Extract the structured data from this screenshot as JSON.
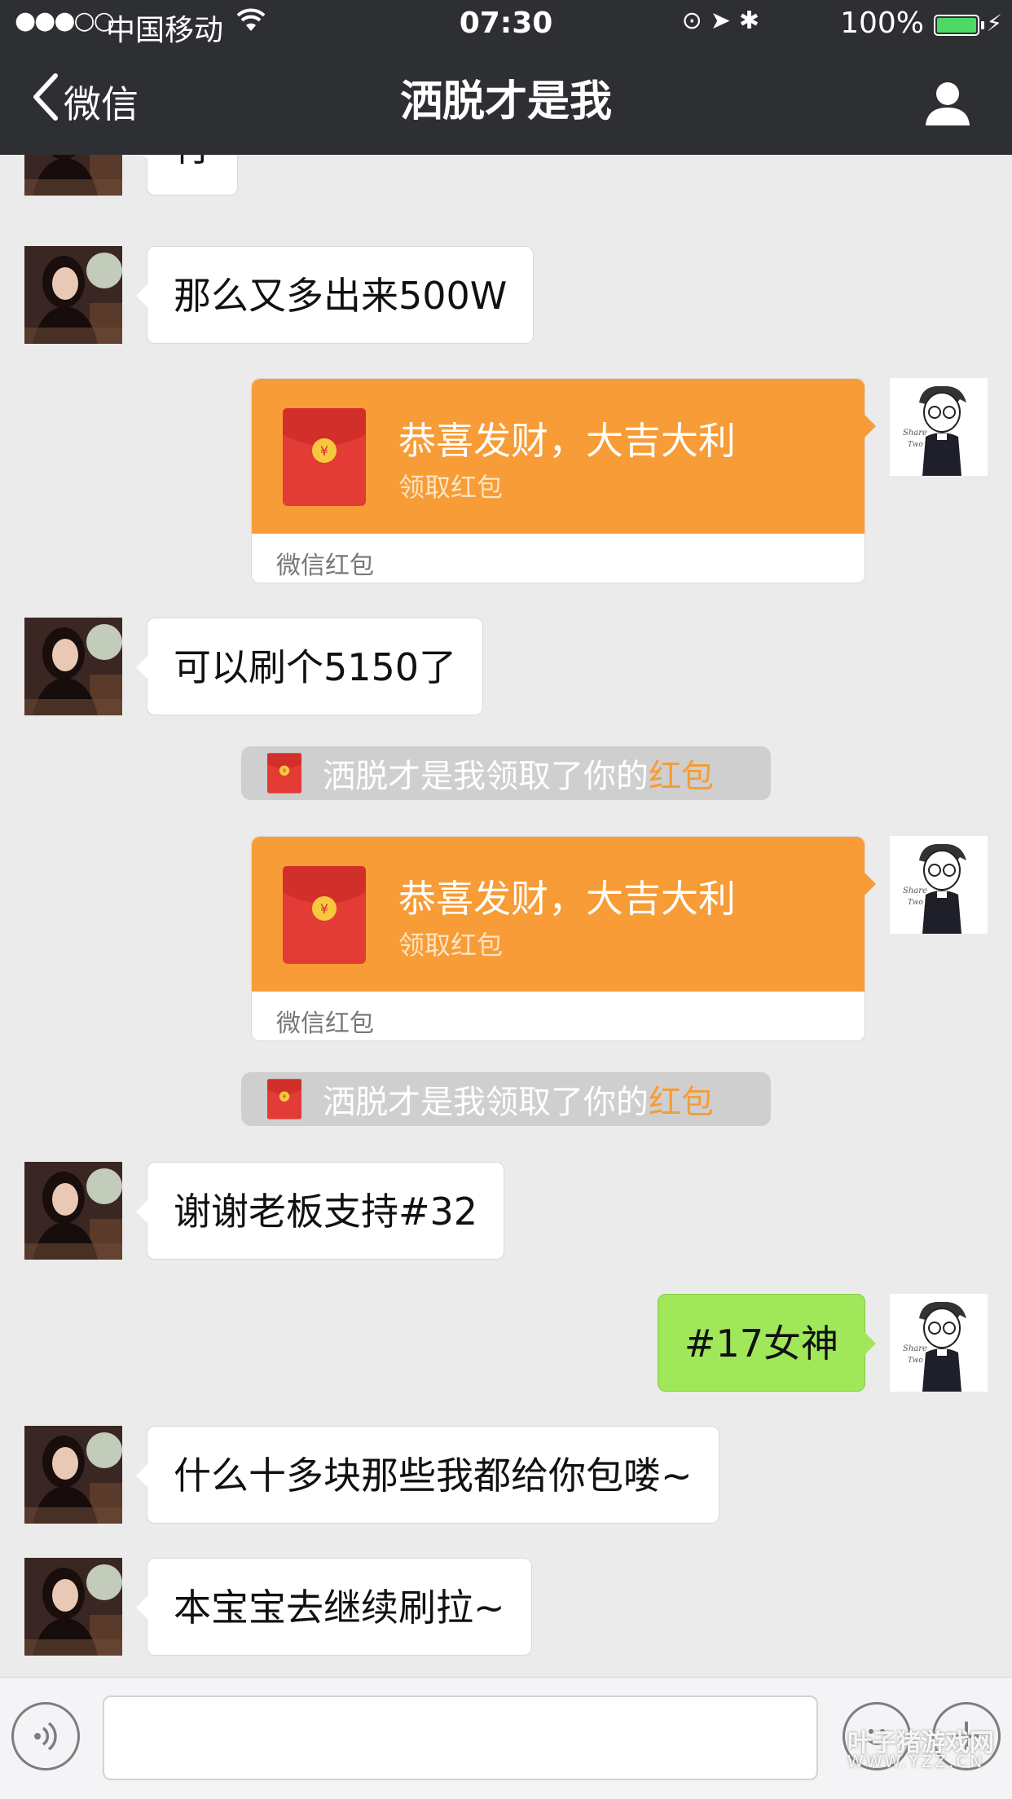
{
  "status_bar": {
    "signal": "●●●○○",
    "carrier": "中国移动",
    "time": "07:30",
    "battery": "100%",
    "battery_level": 1.0
  },
  "nav": {
    "back_label": "微信",
    "title": "洒脱才是我"
  },
  "messages": [
    {
      "side": "left",
      "text": "行"
    },
    {
      "side": "left",
      "text": "那么又多出来500W"
    },
    {
      "side": "right",
      "type": "red_packet",
      "title": "恭喜发财，大吉大利",
      "subtitle": "领取红包",
      "footer": "微信红包"
    },
    {
      "side": "left",
      "text": "可以刷个5150了"
    },
    {
      "type": "notice",
      "text": "洒脱才是我领取了你的",
      "link": "红包"
    },
    {
      "side": "right",
      "type": "red_packet",
      "title": "恭喜发财，大吉大利",
      "subtitle": "领取红包",
      "footer": "微信红包"
    },
    {
      "type": "notice",
      "text": "洒脱才是我领取了你的",
      "link": "红包"
    },
    {
      "side": "left",
      "text": "谢谢老板支持#32"
    },
    {
      "side": "right",
      "text": "#17女神"
    },
    {
      "side": "left",
      "text": "什么十多块那些我都给你包喽~"
    },
    {
      "side": "left",
      "text": "本宝宝去继续刷拉~"
    }
  ],
  "input_bar": {
    "placeholder": ""
  },
  "watermark": {
    "line1": "叶子猪游戏网",
    "line2": "WWW.YZZ.CN"
  },
  "colors": {
    "nav_bg": "#2e2f33",
    "chat_bg": "#ebebeb",
    "bubble_right": "#a0e75a",
    "red_packet": "#f79c36",
    "notice_link": "#f79c36"
  },
  "icons": {
    "back": "chevron-left-icon",
    "profile": "person-icon",
    "voice": "voice-icon",
    "emoji": "emoji-icon",
    "plus": "plus-icon",
    "red_packet": "red-envelope-icon"
  }
}
